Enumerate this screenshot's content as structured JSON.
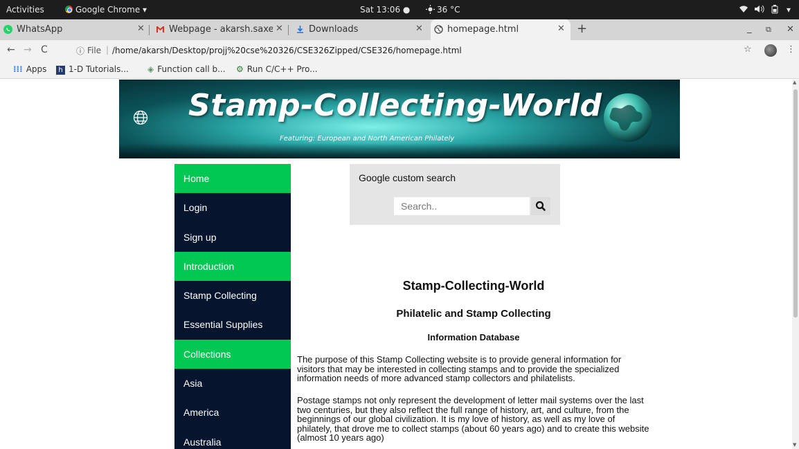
{
  "system_bar": {
    "activities": "Activities",
    "app_menu": "Google Chrome ▾",
    "clock": "Sat 13:06 ●",
    "weather": "36 °C"
  },
  "tabs": [
    {
      "label": "WhatsApp",
      "icon": "whatsapp-icon"
    },
    {
      "label": "Webpage - akarsh.saxena",
      "icon": "gmail-icon"
    },
    {
      "label": "Downloads",
      "icon": "download-icon"
    },
    {
      "label": "homepage.html",
      "icon": "globe-icon"
    }
  ],
  "address_bar": {
    "scheme": "File",
    "url": "/home/akarsh/Desktop/projj%20cse%20326/CSE326Zipped/CSE326/homepage.html"
  },
  "bookmarks": [
    {
      "label": "Apps",
      "icon": "apps-grid-icon"
    },
    {
      "label": "1-D Tutorials...",
      "icon": "h-icon"
    },
    {
      "label": "Function call b...",
      "icon": "diamond-icon"
    },
    {
      "label": "Run C/C++ Pro...",
      "icon": "gear-icon"
    }
  ],
  "banner": {
    "title": "Stamp-Collecting-World",
    "subtitle": "Featuring:  European and North American Philately"
  },
  "nav": [
    {
      "label": "Home",
      "highlight": true
    },
    {
      "label": "Login",
      "highlight": false
    },
    {
      "label": "Sign up",
      "highlight": false
    },
    {
      "label": "Introduction",
      "highlight": true
    },
    {
      "label": "Stamp Collecting",
      "highlight": false
    },
    {
      "label": "Essential Supplies",
      "highlight": false
    },
    {
      "label": "Collections",
      "highlight": true
    },
    {
      "label": "Asia",
      "highlight": false
    },
    {
      "label": "America",
      "highlight": false
    },
    {
      "label": "Australia",
      "highlight": false
    }
  ],
  "search": {
    "label": "Google custom search",
    "placeholder": "Search.."
  },
  "content": {
    "heading": "Stamp-Collecting-World",
    "subheading": "Philatelic and Stamp Collecting",
    "section": "Information Database",
    "paragraph1": "The purpose of this Stamp Collecting website is to provide general information for visitors that may be interested in collecting stamps and to provide the specialized information needs of more advanced stamp collectors and philatelists.",
    "paragraph2": "Postage stamps not only represent the development of letter mail systems over the last two centuries, but they also reflect the full range of history, art, and culture, from the beginnings of our global civilization. It is my love of history, as well as my love of philately, that drove me to collect stamps (about 60 years ago) and to create this website (almost 10 years ago)"
  },
  "colors": {
    "nav_dark": "#06142e",
    "nav_green": "#00c853",
    "search_bg": "#e5e5e5"
  }
}
